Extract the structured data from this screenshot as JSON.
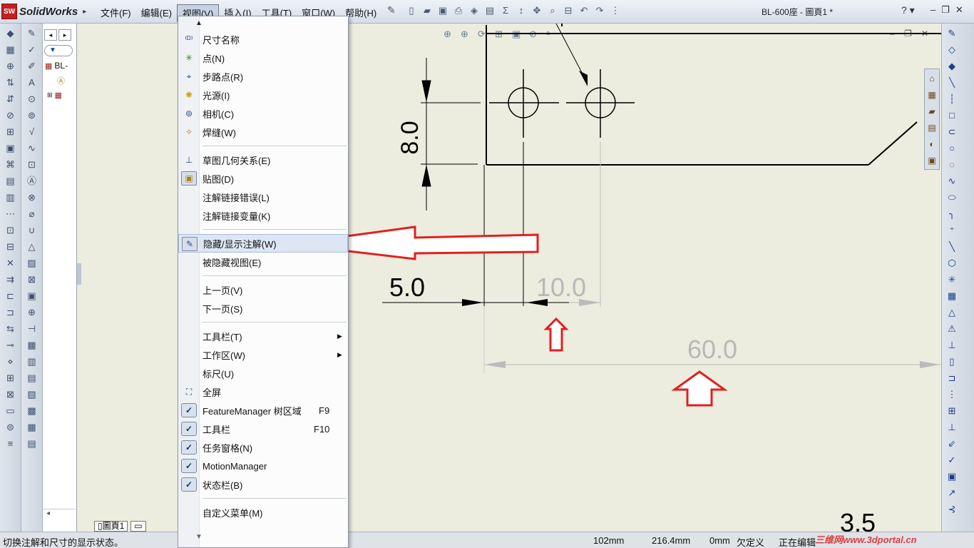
{
  "app": {
    "logo_text": "SolidWorks",
    "window_title": "BL-600座 - 圖頁1 *"
  },
  "menubar": {
    "items": [
      "文件(F)",
      "编辑(E)",
      "视图(V)",
      "插入(I)",
      "工具(T)",
      "窗口(W)",
      "帮助(H)"
    ]
  },
  "feature_tree": {
    "root_label": "BL-",
    "sheet_tab": "圖頁1"
  },
  "view_menu": {
    "items": [
      {
        "label": "尺寸名称",
        "icon": "dimension-names-icon"
      },
      {
        "label": "点(N)",
        "icon": "points-icon"
      },
      {
        "label": "步路点(R)",
        "icon": "route-points-icon"
      },
      {
        "label": "光源(I)",
        "icon": "lights-icon"
      },
      {
        "label": "相机(C)",
        "icon": "cameras-icon"
      },
      {
        "label": "焊缝(W)",
        "icon": "welds-icon"
      },
      {
        "label": "草图几何关系(E)",
        "icon": "sketch-relations-icon"
      },
      {
        "label": "贴图(D)",
        "icon": "decals-icon"
      },
      {
        "label": "注解链接错误(L)",
        "icon": ""
      },
      {
        "label": "注解链接变量(K)",
        "icon": ""
      },
      {
        "label": "隐藏/显示注解(W)",
        "icon": "hide-show-annotations-icon"
      },
      {
        "label": "被隐藏视图(E)",
        "icon": ""
      },
      {
        "label": "上一页(V)",
        "icon": ""
      },
      {
        "label": "下一页(S)",
        "icon": ""
      },
      {
        "label": "工具栏(T)",
        "icon": "",
        "submenu": true
      },
      {
        "label": "工作区(W)",
        "icon": "",
        "submenu": true
      },
      {
        "label": "标尺(U)",
        "icon": ""
      },
      {
        "label": "全屏",
        "icon": "fullscreen-icon"
      },
      {
        "label": "FeatureManager 树区域",
        "shortcut": "F9",
        "checked": true
      },
      {
        "label": "工具栏",
        "shortcut": "F10",
        "checked": true
      },
      {
        "label": "任务窗格(N)",
        "checked": true
      },
      {
        "label": "MotionManager",
        "checked": true
      },
      {
        "label": "状态栏(B)",
        "checked": true
      },
      {
        "label": "自定义菜单(M)",
        "icon": ""
      }
    ]
  },
  "drawing": {
    "dims": {
      "d1": "8.0",
      "d2": "5.0",
      "d3": "10.0",
      "d4": "60.0",
      "d5": "3.5"
    },
    "colors": {
      "highlight_arrow": "#e02020",
      "dim_gray": "#b8b8b8",
      "line": "#000000"
    }
  },
  "status_bar": {
    "message": "切换注解和尺寸的显示状态。",
    "x": "102mm",
    "y": "216.4mm",
    "z": "0mm",
    "state": "欠定义",
    "editing": "正在编辑",
    "watermark": "三维网www.3dportal.cn"
  }
}
